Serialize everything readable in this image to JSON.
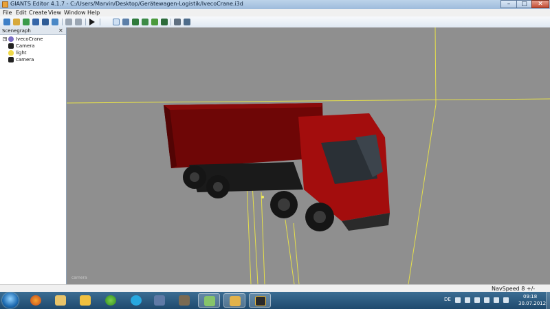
{
  "window": {
    "title": "GIANTS Editor 4.1.7 - C:/Users/Marvin/Desktop/Gerätewagen-Logistik/IvecoCrane.i3d",
    "controls": {
      "minimize": "–",
      "maximize": "□",
      "close": "✕"
    }
  },
  "menu": {
    "items": [
      "File",
      "Edit",
      "Create",
      "View",
      "Window",
      "Help"
    ]
  },
  "toolbar": {
    "tools": [
      "new-icon",
      "open-icon",
      "reload-icon",
      "save-icon",
      "save-as-icon",
      "import-icon",
      "undo-icon",
      "redo-icon",
      "play-icon",
      "select-icon",
      "magnet-icon",
      "terrain-icon",
      "terrain-paint-icon",
      "foliage-icon",
      "detail-icon",
      "grid-icon",
      "grid-snap-icon"
    ]
  },
  "scenegraph": {
    "title": "Scenegraph",
    "close": "✕",
    "nodes": [
      {
        "label": "IvecoCrane",
        "icon": "transform-group-icon",
        "expander": "+"
      },
      {
        "label": "Camera",
        "icon": "camera-icon"
      },
      {
        "label": "light",
        "icon": "light-bulb-icon"
      },
      {
        "label": "camera",
        "icon": "camera-icon"
      }
    ]
  },
  "viewport": {
    "camera_label": "camera",
    "background": "#8f8f8f",
    "grid_line_color": "#e6e04a",
    "truck_color": "#a30d0d"
  },
  "status": {
    "nav_speed": "NavSpeed 8 +/-"
  },
  "taskbar": {
    "apps": [
      "firefox-icon",
      "explorer-icon",
      "mail-icon",
      "icq-icon",
      "skype-icon",
      "editor-icon",
      "gimp-icon",
      "game-folder-icon",
      "folder-icon",
      "giants-editor-icon"
    ],
    "language": "DE",
    "time": "09:18",
    "date": "30.07.2012"
  }
}
